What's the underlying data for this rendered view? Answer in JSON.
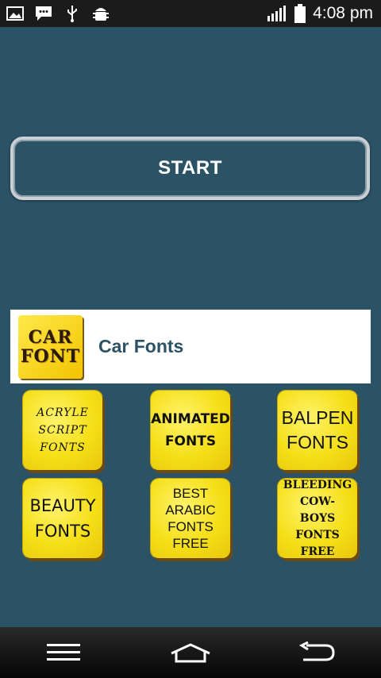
{
  "status_bar": {
    "time": "4:08 pm",
    "icons": [
      "gallery-icon",
      "message-icon",
      "usb-icon",
      "android-debug-icon",
      "signal-icon",
      "battery-icon"
    ]
  },
  "start_button": {
    "label": "START"
  },
  "featured_app": {
    "icon_text": [
      "CAR",
      "FONT"
    ],
    "title": "Car Fonts"
  },
  "tiles": [
    {
      "text": "ACRYLE\nSCRIPT\nFONTS"
    },
    {
      "text": "ANIMATED\nFONTS"
    },
    {
      "text": "BALPEN\nFONTS"
    },
    {
      "text": "BEAUTY\nFONTS"
    },
    {
      "text": "BEST\nARABIC\nFONTS\nFREE"
    },
    {
      "text": "BLEEDING\nCOW-BOYS\nFONTS\nFREE"
    }
  ],
  "nav_bar": {
    "buttons": [
      "menu-icon",
      "home-icon",
      "back-icon"
    ]
  },
  "colors": {
    "background": "#2b5265",
    "tile_yellow": "#f5df18",
    "title_blue": "#2b5265"
  }
}
